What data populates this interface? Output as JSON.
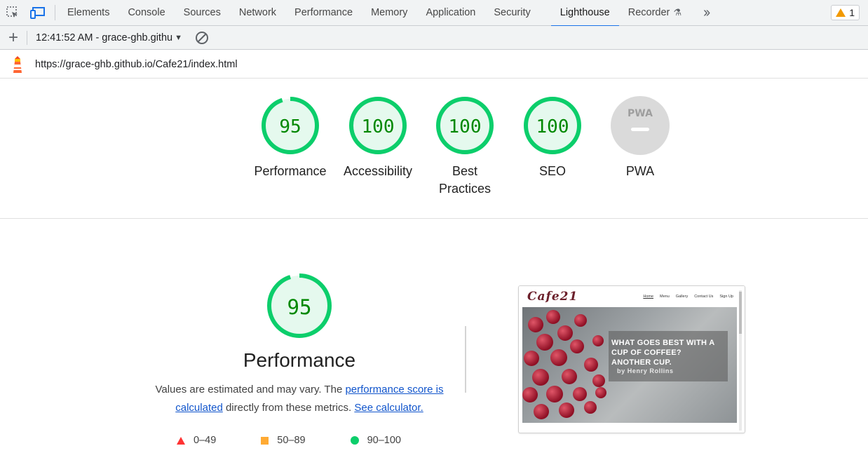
{
  "devtools": {
    "tabs": [
      "Elements",
      "Console",
      "Sources",
      "Network",
      "Performance",
      "Memory",
      "Application",
      "Security",
      "Lighthouse",
      "Recorder"
    ],
    "active_tab": "Lighthouse",
    "warning_count": "1"
  },
  "toolbar": {
    "report_label": "12:41:52 AM - grace-ghb.githu"
  },
  "report": {
    "url": "https://grace-ghb.github.io/Cafe21/index.html"
  },
  "gauges": [
    {
      "score": "95",
      "label": "Performance",
      "color": "#0cce6b"
    },
    {
      "score": "100",
      "label": "Accessibility",
      "color": "#0cce6b"
    },
    {
      "score": "100",
      "label": "Best Practices",
      "color": "#0cce6b"
    },
    {
      "score": "100",
      "label": "SEO",
      "color": "#0cce6b"
    },
    {
      "score": "",
      "label": "PWA",
      "color": "#9e9e9e",
      "badge_text": "PWA"
    }
  ],
  "performance": {
    "score": "95",
    "title": "Performance",
    "desc_prefix": "Values are estimated and may vary. The ",
    "link1": "performance score is calculated",
    "desc_middle": " directly from these metrics. ",
    "link2": "See calculator."
  },
  "legend": {
    "fail": "0–49",
    "average": "50–89",
    "pass": "90–100"
  },
  "thumbnail": {
    "logo": "Cafe21",
    "nav": [
      "Home",
      "Menu",
      "Gallery",
      "Contact Us",
      "Sign Up"
    ],
    "hero_line1": "WHAT GOES BEST WITH A",
    "hero_line2": "CUP OF COFFEE?",
    "hero_line3": "ANOTHER CUP.",
    "hero_byline": "by Henry Rollins"
  },
  "colors": {
    "pass": "#0cce6b",
    "pass_text": "#008800",
    "pass_fill": "#e5f9ee",
    "accent": "#1a73e8"
  }
}
